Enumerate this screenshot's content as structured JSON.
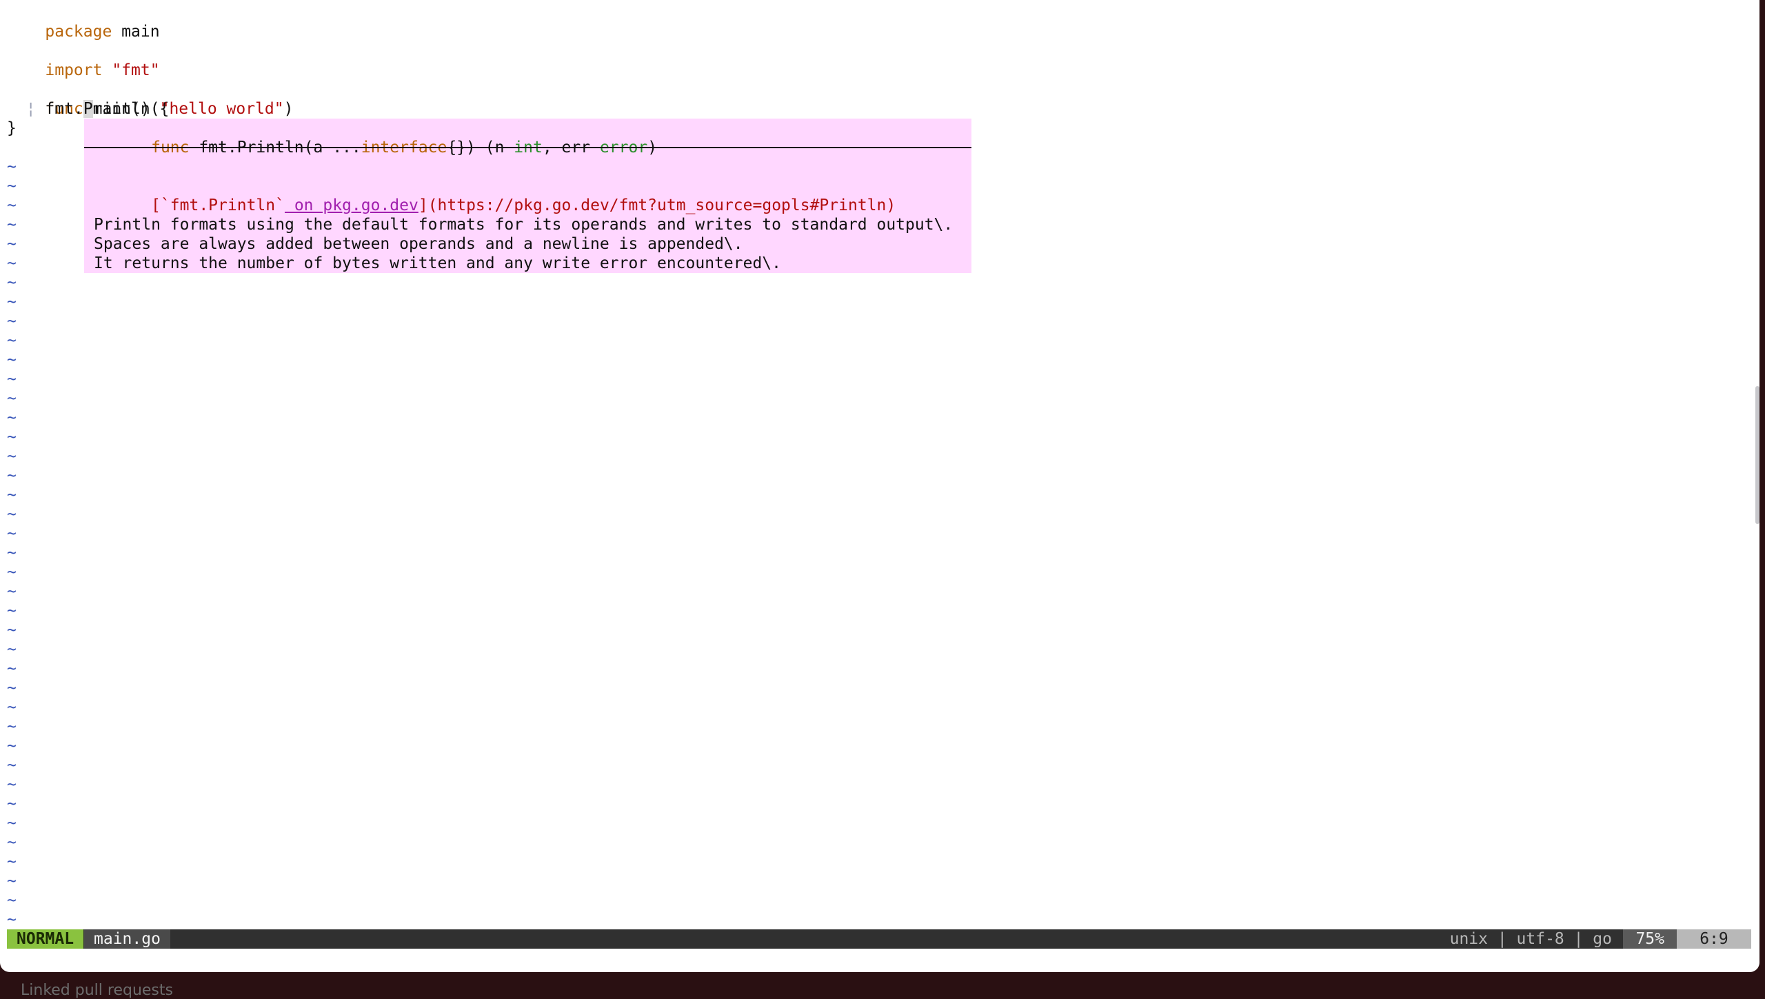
{
  "code": {
    "line1_kw": "package",
    "line1_rest": " main",
    "line3_kw": "import",
    "line3_str": " \"fmt\"",
    "line5_kw": "func",
    "line5_rest": " main() {",
    "line6_guide": "¦",
    "line6_pre": " fmt.",
    "line6_cursor": "P",
    "line6_mid": "rintln(",
    "line6_str": "\"hello world\"",
    "line6_end": ")",
    "line7": "}",
    "tilde": "~"
  },
  "popup": {
    "sig_kw": "func",
    "sig_a": " fmt.Println(a ...",
    "sig_iface": "interface",
    "sig_b": "{}) (n ",
    "sig_int": "int",
    "sig_c": ", err ",
    "sig_error": "error",
    "sig_d": ")",
    "link_open": "[`fmt.Println`",
    "link_text": " on pkg.go.dev",
    "link_close": "](https://pkg.go.dev/fmt?utm_source=gopls#Println)",
    "doc_line1": "Println formats using the default formats for its operands and writes to standard output\\.",
    "doc_line2": "Spaces are always added between operands and a newline is appended\\.",
    "doc_line3": "It returns the number of bytes written and any write error encountered\\."
  },
  "statusline": {
    "mode": "NORMAL",
    "filename": "main.go",
    "fileinfo": "unix | utf-8 | go",
    "percent": "75%",
    "position": "6:9"
  },
  "background_text": "Linked pull requests"
}
